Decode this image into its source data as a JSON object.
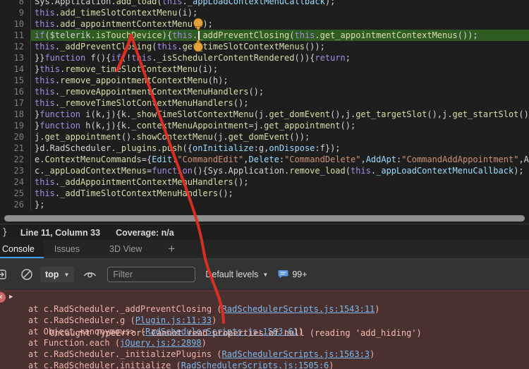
{
  "source": {
    "current_line": 11,
    "caret_position": {
      "line": 11,
      "column": 33
    },
    "lines": [
      {
        "num": "8",
        "tokens": [
          [
            "w",
            "Sys.Application."
          ],
          [
            "y",
            "add_load"
          ],
          [
            "w",
            "("
          ],
          [
            "k",
            "this"
          ],
          [
            "w",
            "."
          ],
          [
            "b",
            "_appLoadContextMenuCallback"
          ],
          [
            "w",
            ");"
          ]
        ]
      },
      {
        "num": "9",
        "tokens": [
          [
            "k",
            "this"
          ],
          [
            "w",
            "."
          ],
          [
            "y",
            "add_timeSlotContextMenu"
          ],
          [
            "w",
            "(i);"
          ]
        ]
      },
      {
        "num": "10",
        "tokens": [
          [
            "k",
            "this"
          ],
          [
            "w",
            "."
          ],
          [
            "y",
            "add_appointmentContextMenu"
          ],
          [
            "w",
            "(h);"
          ]
        ]
      },
      {
        "num": "11",
        "tokens": [
          [
            "k",
            "if"
          ],
          [
            "w",
            "($telerik."
          ],
          [
            "y",
            "isTouchDevice"
          ],
          [
            "w",
            "){"
          ],
          [
            "k",
            "this"
          ],
          [
            "w",
            "."
          ],
          [
            "y",
            "_addPreventClosing"
          ],
          [
            "w",
            "("
          ],
          [
            "k",
            "this"
          ],
          [
            "w",
            "."
          ],
          [
            "y",
            "get_appointmentContextMenus"
          ],
          [
            "w",
            "());"
          ]
        ]
      },
      {
        "num": "12",
        "tokens": [
          [
            "k",
            "this"
          ],
          [
            "w",
            "."
          ],
          [
            "y",
            "_addPreventClosing"
          ],
          [
            "w",
            "("
          ],
          [
            "k",
            "this"
          ],
          [
            "w",
            "."
          ],
          [
            "y",
            "get_timeSlotContextMenus"
          ],
          [
            "w",
            "());"
          ]
        ]
      },
      {
        "num": "13",
        "tokens": [
          [
            "w",
            "}}"
          ],
          [
            "k",
            "function"
          ],
          [
            "w",
            " f(){"
          ],
          [
            "k",
            "if"
          ],
          [
            "w",
            "(!"
          ],
          [
            "k",
            "this"
          ],
          [
            "w",
            "."
          ],
          [
            "y",
            "_isSchedulerContentRendered"
          ],
          [
            "w",
            "()){"
          ],
          [
            "k",
            "return"
          ],
          [
            "w",
            ";"
          ]
        ]
      },
      {
        "num": "14",
        "tokens": [
          [
            "w",
            "}"
          ],
          [
            "k",
            "this"
          ],
          [
            "w",
            "."
          ],
          [
            "y",
            "remove_timeSlotContextMenu"
          ],
          [
            "w",
            "(i);"
          ]
        ]
      },
      {
        "num": "15",
        "tokens": [
          [
            "k",
            "this"
          ],
          [
            "w",
            "."
          ],
          [
            "y",
            "remove_appointmentContextMenu"
          ],
          [
            "w",
            "(h);"
          ]
        ]
      },
      {
        "num": "16",
        "tokens": [
          [
            "k",
            "this"
          ],
          [
            "w",
            "."
          ],
          [
            "y",
            "_removeAppointmentContextMenuHandlers"
          ],
          [
            "w",
            "();"
          ]
        ]
      },
      {
        "num": "17",
        "tokens": [
          [
            "k",
            "this"
          ],
          [
            "w",
            "."
          ],
          [
            "y",
            "_removeTimeSlotContextMenuHandlers"
          ],
          [
            "w",
            "();"
          ]
        ]
      },
      {
        "num": "18",
        "tokens": [
          [
            "w",
            "}"
          ],
          [
            "k",
            "function"
          ],
          [
            "w",
            " i(k,j){k."
          ],
          [
            "y",
            "_showTimeSlotContextMenu"
          ],
          [
            "w",
            "(j."
          ],
          [
            "y",
            "get_domEvent"
          ],
          [
            "w",
            "(),j."
          ],
          [
            "y",
            "get_targetSlot"
          ],
          [
            "w",
            "(),j."
          ],
          [
            "y",
            "get_startSlot"
          ],
          [
            "w",
            "()"
          ]
        ]
      },
      {
        "num": "19",
        "tokens": [
          [
            "w",
            "}"
          ],
          [
            "k",
            "function"
          ],
          [
            "w",
            " h(k,j){k."
          ],
          [
            "y",
            "_contextMenuAppointment"
          ],
          [
            "w",
            "=j."
          ],
          [
            "y",
            "get_appointment"
          ],
          [
            "w",
            "();"
          ]
        ]
      },
      {
        "num": "20",
        "tokens": [
          [
            "w",
            "j."
          ],
          [
            "y",
            "get_appointment"
          ],
          [
            "w",
            "()."
          ],
          [
            "y",
            "showContextMenu"
          ],
          [
            "w",
            "(j."
          ],
          [
            "y",
            "get_domEvent"
          ],
          [
            "w",
            "());"
          ]
        ]
      },
      {
        "num": "21",
        "tokens": [
          [
            "w",
            "}d.RadScheduler."
          ],
          [
            "y",
            "_plugins"
          ],
          [
            "w",
            "."
          ],
          [
            "y",
            "push"
          ],
          [
            "w",
            "({"
          ],
          [
            "b",
            "onInitialize"
          ],
          [
            "w",
            ":g,"
          ],
          [
            "b",
            "onDispose"
          ],
          [
            "w",
            ":f});"
          ]
        ]
      },
      {
        "num": "22",
        "tokens": [
          [
            "w",
            "e."
          ],
          [
            "y",
            "ContextMenuCommands"
          ],
          [
            "w",
            "={"
          ],
          [
            "b",
            "Edit"
          ],
          [
            "w",
            ":"
          ],
          [
            "s",
            "\"CommandEdit\""
          ],
          [
            "w",
            ","
          ],
          [
            "b",
            "Delete"
          ],
          [
            "w",
            ":"
          ],
          [
            "s",
            "\"CommandDelete\""
          ],
          [
            "w",
            ","
          ],
          [
            "b",
            "AddApt"
          ],
          [
            "w",
            ":"
          ],
          [
            "s",
            "\"CommandAddAppointment\""
          ],
          [
            "w",
            ",A"
          ]
        ]
      },
      {
        "num": "23",
        "tokens": [
          [
            "w",
            "c."
          ],
          [
            "y",
            "_appLoadContextMenus"
          ],
          [
            "w",
            "="
          ],
          [
            "k",
            "function"
          ],
          [
            "w",
            "(){Sys.Application."
          ],
          [
            "y",
            "remove_load"
          ],
          [
            "w",
            "("
          ],
          [
            "k",
            "this"
          ],
          [
            "w",
            "."
          ],
          [
            "b",
            "_appLoadContextMenuCallback"
          ],
          [
            "w",
            ");"
          ]
        ]
      },
      {
        "num": "24",
        "tokens": [
          [
            "k",
            "this"
          ],
          [
            "w",
            "."
          ],
          [
            "y",
            "_addAppointmentContextMenuHandlers"
          ],
          [
            "w",
            "();"
          ]
        ]
      },
      {
        "num": "25",
        "tokens": [
          [
            "k",
            "this"
          ],
          [
            "w",
            "."
          ],
          [
            "y",
            "_addTimeSlotContextMenuHandlers"
          ],
          [
            "w",
            "();"
          ]
        ]
      },
      {
        "num": "26",
        "tokens": [
          [
            "w",
            "};"
          ]
        ]
      }
    ]
  },
  "status_bar": {
    "brace": "}",
    "position": "Line 11, Column 33",
    "coverage": "Coverage: n/a"
  },
  "drawer": {
    "tabs": [
      {
        "label": "Console",
        "active": true
      },
      {
        "label": "Issues",
        "active": false
      },
      {
        "label": "3D View",
        "active": false
      }
    ],
    "add_tab": "+"
  },
  "toolbar": {
    "context_selected": "top",
    "filter_placeholder": "Filter",
    "levels_label": "Default levels",
    "issues_count": "99+"
  },
  "console": {
    "error_badge": "✕",
    "expand_glyph": "▶",
    "message": "Uncaught TypeError: Cannot read properties of null (reading 'add_hiding')",
    "stack": [
      {
        "prefix": "at c.RadScheduler._addPreventClosing (",
        "link": "RadSchedulerScripts.js:1543:11",
        "suffix": ")"
      },
      {
        "prefix": "at c.RadScheduler.g (",
        "link": "Plugin.js:11:33",
        "suffix": ")"
      },
      {
        "prefix": "at Object.<anonymous> (",
        "link": "RadSchedulerScripts.js:1563:61",
        "suffix": ")"
      },
      {
        "prefix": "at Function.each (",
        "link": "jQuery.js:2:2898",
        "suffix": ")"
      },
      {
        "prefix": "at c.RadScheduler._initializePlugins (",
        "link": "RadSchedulerScripts.js:1563:3",
        "suffix": ")"
      },
      {
        "prefix": "at c.RadScheduler.initialize (",
        "link": "RadSchedulerScripts.js:1505:6",
        "suffix": ")"
      }
    ]
  },
  "colors": {
    "accent_blue": "#38a0f2",
    "paused_line_green": "#2e5c22",
    "error_background": "#4a3130",
    "error_text": "#efb4ac",
    "link_blue": "#7cb9f0",
    "annotation_red": "#e02f23",
    "pin_orange": "#e2a23b",
    "keyword_violet": "#ab8be0",
    "function_yellow": "#dcdcaa",
    "string_orange": "#ce9178"
  }
}
